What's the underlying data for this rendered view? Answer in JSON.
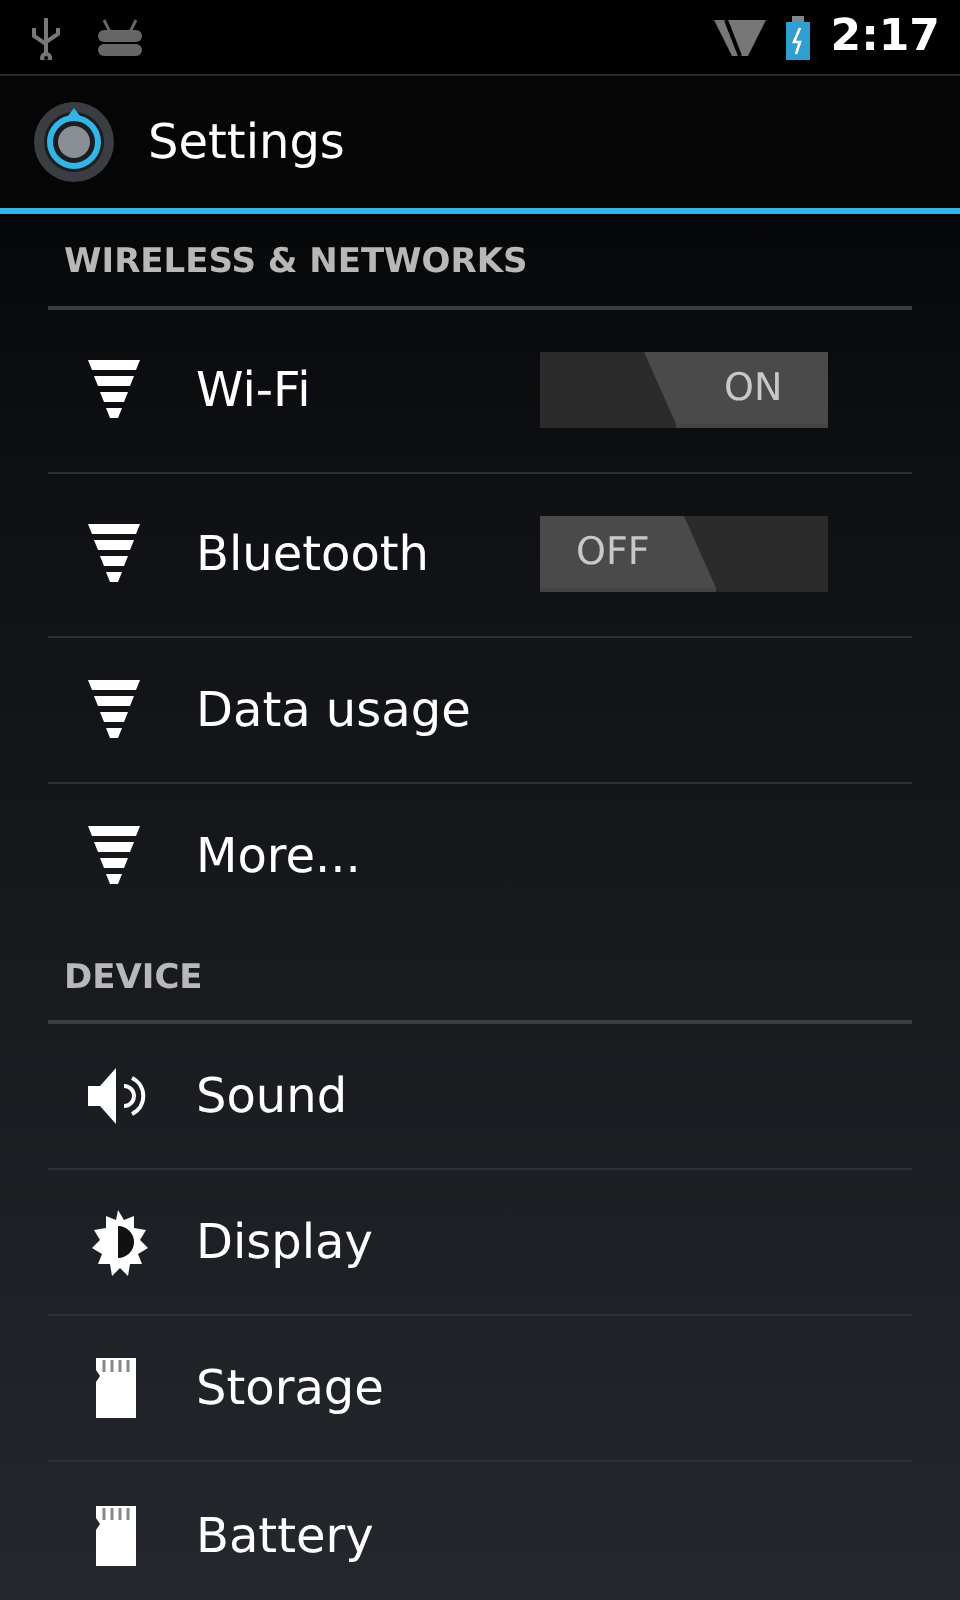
{
  "status_bar": {
    "time": "2:17"
  },
  "action_bar": {
    "title": "Settings"
  },
  "sections": [
    {
      "header": "WIRELESS & NETWORKS",
      "items": [
        {
          "label": "Wi-Fi",
          "kind": "toggle",
          "on": true,
          "toggle_label": "ON"
        },
        {
          "label": "Bluetooth",
          "kind": "toggle",
          "on": false,
          "toggle_label": "OFF"
        },
        {
          "label": "Data usage",
          "kind": "link"
        },
        {
          "label": "More...",
          "kind": "link"
        }
      ]
    },
    {
      "header": "DEVICE",
      "items": [
        {
          "label": "Sound",
          "kind": "link"
        },
        {
          "label": "Display",
          "kind": "link"
        },
        {
          "label": "Storage",
          "kind": "link"
        },
        {
          "label": "Battery",
          "kind": "link"
        }
      ]
    }
  ]
}
